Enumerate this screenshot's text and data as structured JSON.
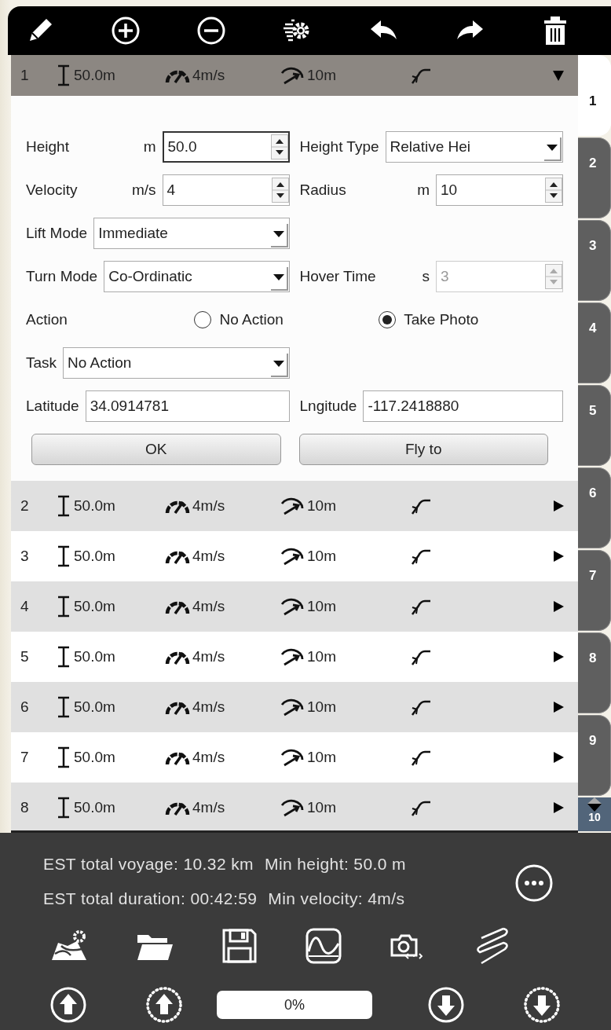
{
  "waypoints": [
    {
      "number": "1",
      "height": "50.0m",
      "velocity": "4m/s",
      "radius": "10m",
      "expanded": true
    },
    {
      "number": "2",
      "height": "50.0m",
      "velocity": "4m/s",
      "radius": "10m",
      "expanded": false
    },
    {
      "number": "3",
      "height": "50.0m",
      "velocity": "4m/s",
      "radius": "10m",
      "expanded": false
    },
    {
      "number": "4",
      "height": "50.0m",
      "velocity": "4m/s",
      "radius": "10m",
      "expanded": false
    },
    {
      "number": "5",
      "height": "50.0m",
      "velocity": "4m/s",
      "radius": "10m",
      "expanded": false
    },
    {
      "number": "6",
      "height": "50.0m",
      "velocity": "4m/s",
      "radius": "10m",
      "expanded": false
    },
    {
      "number": "7",
      "height": "50.0m",
      "velocity": "4m/s",
      "radius": "10m",
      "expanded": false
    },
    {
      "number": "8",
      "height": "50.0m",
      "velocity": "4m/s",
      "radius": "10m",
      "expanded": false
    }
  ],
  "form": {
    "rows": [
      {
        "kind": "pair",
        "fields": [
          {
            "label": "Height",
            "unit": "m",
            "kind": "spin",
            "value": "50.0",
            "focused": true,
            "disabled": false
          },
          {
            "label": "Height Type",
            "kind": "select",
            "value": "Relative Hei",
            "focused": false,
            "disabled": false
          }
        ]
      },
      {
        "kind": "pair",
        "fields": [
          {
            "label": "Velocity",
            "unit": "m/s",
            "kind": "spin",
            "value": "4",
            "focused": false,
            "disabled": false
          },
          {
            "label": "Radius",
            "unit": "m",
            "kind": "spin",
            "value": "10",
            "focused": false,
            "disabled": false
          }
        ]
      },
      {
        "kind": "pair",
        "fields": [
          {
            "label": "Lift Mode",
            "kind": "select",
            "value": "Immediate",
            "focused": false,
            "disabled": false
          }
        ]
      },
      {
        "kind": "pair",
        "fields": [
          {
            "label": "Turn Mode",
            "kind": "select",
            "value": "Co-Ordinatic",
            "focused": false,
            "disabled": false
          },
          {
            "label": "Hover Time",
            "unit": "s",
            "kind": "spin",
            "value": "3",
            "focused": false,
            "disabled": true
          }
        ]
      },
      {
        "kind": "radio",
        "label": "Action",
        "options": [
          {
            "label": "No Action",
            "selected": false
          },
          {
            "label": "Take Photo",
            "selected": true
          }
        ]
      },
      {
        "kind": "pair",
        "fields": [
          {
            "label": "Task",
            "kind": "select",
            "value": "No Action",
            "focused": false,
            "disabled": false
          }
        ]
      },
      {
        "kind": "pair",
        "fields": [
          {
            "label": "Latitude",
            "kind": "text",
            "value": "34.0914781",
            "focused": false,
            "disabled": false
          },
          {
            "label": "Lngitude",
            "kind": "text",
            "value": "-117.2418880",
            "focused": false,
            "disabled": false
          }
        ]
      }
    ],
    "buttons": [
      "OK",
      "Fly to"
    ]
  },
  "tabs": [
    {
      "label": "1",
      "selected": true
    },
    {
      "label": "2",
      "selected": false
    },
    {
      "label": "3",
      "selected": false
    },
    {
      "label": "4",
      "selected": false
    },
    {
      "label": "5",
      "selected": false
    },
    {
      "label": "6",
      "selected": false
    },
    {
      "label": "7",
      "selected": false
    },
    {
      "label": "8",
      "selected": false
    },
    {
      "label": "9",
      "selected": false
    },
    {
      "label": "10",
      "selected": false
    }
  ],
  "summary": [
    {
      "left": "EST total voyage: 10.32 km",
      "right": "Min height: 50.0 m"
    },
    {
      "left": "EST total duration: 00:42:59",
      "right": "Min velocity: 4m/s"
    }
  ],
  "progress": {
    "label": "0%",
    "level": 0
  }
}
